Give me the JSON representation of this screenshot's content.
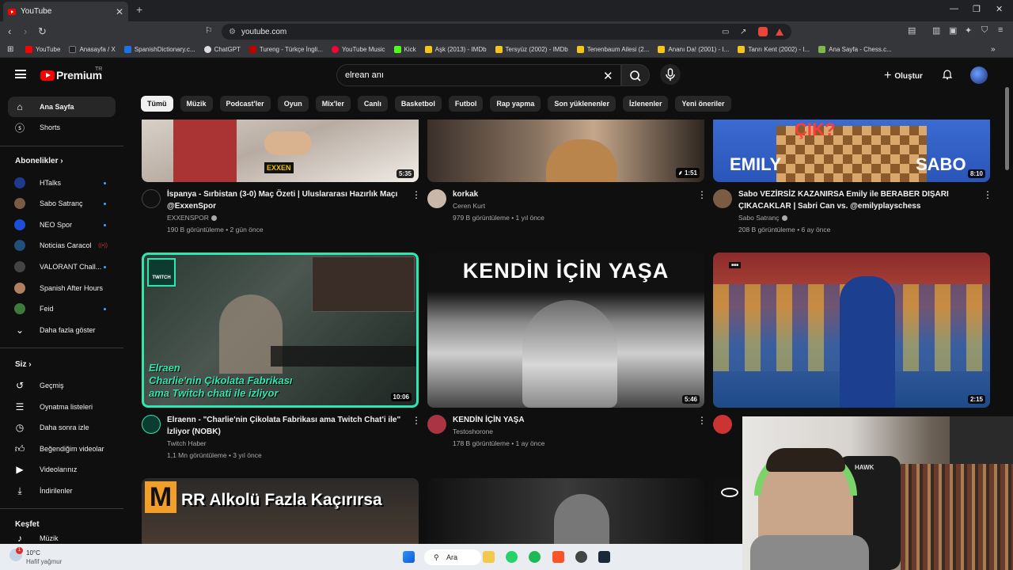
{
  "browser": {
    "tab_title": "YouTube",
    "url": "youtube.com",
    "bookmarks": [
      {
        "label": "YouTube",
        "color": "#ff0000"
      },
      {
        "label": "Anasayfa / X",
        "color": "#222222"
      },
      {
        "label": "SpanishDictionary.c...",
        "color": "#1a73e8"
      },
      {
        "label": "ChatGPT",
        "color": "#dddddd"
      },
      {
        "label": "Tureng - Türkçe İngli...",
        "color": "#c00000"
      },
      {
        "label": "YouTube Music",
        "color": "#ff0033"
      },
      {
        "label": "Kick",
        "color": "#53fc18"
      },
      {
        "label": "Aşk (2013) - IMDb",
        "color": "#f5c518"
      },
      {
        "label": "Tersyüz (2002) - IMDb",
        "color": "#f5c518"
      },
      {
        "label": "Tenenbaum Ailesi (2...",
        "color": "#f5c518"
      },
      {
        "label": "Ananı Da! (2001) - I...",
        "color": "#f5c518"
      },
      {
        "label": "Tanrı Kent (2002) - I...",
        "color": "#f5c518"
      },
      {
        "label": "Ana Sayfa - Chess.c...",
        "color": "#81b64c"
      }
    ]
  },
  "header": {
    "logo": "Premium",
    "region": "TR",
    "search_value": "elrean anı",
    "create_label": "Oluştur"
  },
  "sidebar": {
    "main": [
      {
        "label": "Ana Sayfa"
      },
      {
        "label": "Shorts"
      }
    ],
    "subs_title": "Abonelikler",
    "subs": [
      {
        "label": "HTalks",
        "color": "#1e3a8a"
      },
      {
        "label": "Sabo Satranç",
        "color": "#7a5c44"
      },
      {
        "label": "NEO Spor",
        "color": "#1d4ed8"
      },
      {
        "label": "Noticias Caracol",
        "color": "#1f4f7a"
      },
      {
        "label": "VALORANT Chall...",
        "color": "#444444"
      },
      {
        "label": "Spanish After Hours",
        "color": "#b08060"
      },
      {
        "label": "Feid",
        "color": "#3b7a3b"
      }
    ],
    "more_label": "Daha fazla göster",
    "you_title": "Siz",
    "you": [
      {
        "label": "Geçmiş"
      },
      {
        "label": "Oynatma listeleri"
      },
      {
        "label": "Daha sonra izle"
      },
      {
        "label": "Beğendiğim videolar"
      },
      {
        "label": "Videolarınız"
      },
      {
        "label": "İndirilenler"
      }
    ],
    "explore_title": "Keşfet",
    "explore_first": "Müzik"
  },
  "chips": [
    "Tümü",
    "Müzik",
    "Podcast'ler",
    "Oyun",
    "Mix'ler",
    "Canlı",
    "Basketbol",
    "Futbol",
    "Rap yapma",
    "Son yüklenenler",
    "İzlenenler",
    "Yeni öneriler"
  ],
  "videos": [
    {
      "title1": "İspanya - Sırbistan (3-0) Maç Özeti | Uluslararası Hazırlık Maçı",
      "title2": "@ExxenSpor",
      "channel": "EXXENSPOR",
      "meta": "190 B görüntüleme • 2 gün önce",
      "duration": "5:35",
      "thumb_text": "EXXEN"
    },
    {
      "title1": "korkak",
      "title2": "",
      "channel": "Ceren Kurt",
      "meta": "979 B görüntüleme • 1 yıl önce",
      "duration": "1:51",
      "thumb_text": ""
    },
    {
      "title1": "Sabo VEZİRSİZ KAZANIRSA Emily ile BERABER DIŞARI",
      "title2": "ÇIKACAKLAR | Sabri Can vs. @emilyplayschess",
      "channel": "Sabo Satranç",
      "meta": "208 B görüntüleme • 6 ay önce",
      "duration": "8:10",
      "thumb_text1": "ÇIK?",
      "thumb_text2": "EMILY",
      "thumb_text3": "SABO"
    },
    {
      "title1": "Elraenn - \"Charlie'nin Çikolata Fabrikası ama Twitch Chat'i ile\"",
      "title2": "İzliyor (NOBK)",
      "channel": "Twitch Haber",
      "meta": "1,1 Mn görüntüleme • 3 yıl önce",
      "duration": "10:06",
      "thumb_text1": "Elraen",
      "thumb_text2": "Charlie'nin Çikolata Fabrikası",
      "thumb_text3": "ama Twitch chati ile izliyor"
    },
    {
      "title1": "KENDİN İÇİN YAŞA",
      "title2": "",
      "channel": "Testoshorone",
      "meta": "178 B görüntüleme • 1 ay önce",
      "duration": "5:46",
      "thumb_text": "KENDİN İÇİN YAŞA"
    },
    {
      "title1": "",
      "title2": "",
      "channel": "",
      "meta": "",
      "duration": "2:15",
      "thumb_text": ""
    },
    {
      "thumb_text": "RR Alkolü Fazla Kaçırırsa"
    }
  ],
  "taskbar": {
    "temp": "10°C",
    "weather": "Hafif yağmur",
    "search": "Ara",
    "badge": "1"
  }
}
